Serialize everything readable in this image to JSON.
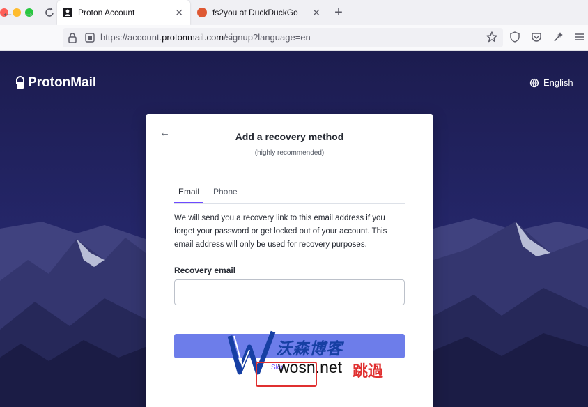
{
  "browser": {
    "window_controls": [
      "close",
      "minimize",
      "zoom"
    ],
    "tabs": [
      {
        "title": "Proton Account",
        "icon": "proton-favicon",
        "active": true
      },
      {
        "title": "fs2you at DuckDuckGo",
        "icon": "duckduckgo-favicon",
        "active": false
      }
    ],
    "new_tab_label": "+",
    "url": {
      "prefix": "https://account.",
      "host": "protonmail.com",
      "path": "/signup?language=en"
    }
  },
  "page": {
    "brand": "ProtonMail",
    "language": "English",
    "card": {
      "title": "Add a recovery method",
      "subtitle": "(highly recommended)",
      "tabs": [
        "Email",
        "Phone"
      ],
      "selected_tab": "Email",
      "description": "We will send you a recovery link to this email address if you forget your password or get locked out of your account. This email address will only be used for recovery purposes.",
      "field_label": "Recovery email",
      "field_value": "",
      "skip_label": "Skip"
    }
  },
  "watermark": {
    "brand_cn": "沃森博客",
    "domain": "wosn.net",
    "overlay": "跳過"
  },
  "colors": {
    "page_bg": "#1c1c4f",
    "primary": "#6d4aff",
    "cta": "#6d7dea",
    "watermark_blue": "#163fa3",
    "watermark_red": "#e03030"
  }
}
